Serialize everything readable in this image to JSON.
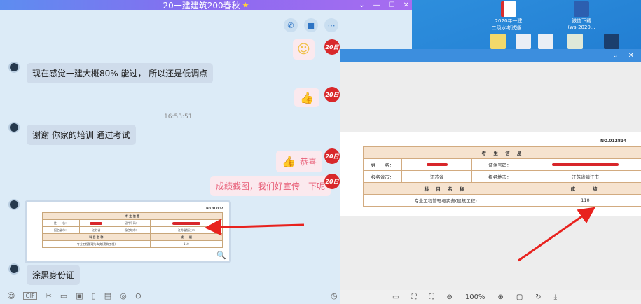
{
  "chat": {
    "title": "20一建建筑200春秋",
    "title_star": "★",
    "timestamp": "16:53:51",
    "messages": [
      {
        "side": "right",
        "kind": "emoji",
        "glyph": "☺"
      },
      {
        "side": "left",
        "text": "现在感觉一建大概80% 能过， 所以还是低调点"
      },
      {
        "side": "right",
        "kind": "thumb",
        "glyph": "👍"
      },
      {
        "side": "left",
        "text": "谢谢 你家的培训 通过考试"
      },
      {
        "side": "right",
        "kind": "thumb-text",
        "glyph": "👍",
        "text": "恭喜"
      },
      {
        "side": "right",
        "text": "成绩截图，我们好宣传一下呢"
      },
      {
        "side": "left",
        "kind": "image"
      },
      {
        "side": "left",
        "text": "涂黑身份证"
      }
    ],
    "avatar_right_label": "20日",
    "top_icons": [
      "phone-icon",
      "video-icon",
      "more-icon"
    ],
    "bottom_icons": [
      "emoji-icon",
      "gif-icon",
      "scissors-icon",
      "folder-icon",
      "image-icon",
      "phone-icon",
      "calendar-icon",
      "voice-icon",
      "more-icon",
      "clock-icon"
    ],
    "gif_label": "GIF"
  },
  "desktop": {
    "icons": [
      {
        "label1": "2020年一建",
        "label2": "二级水考试通..."
      },
      {
        "label1": "微信下载",
        "label2": "(ws-2020..."
      }
    ]
  },
  "score_table": {
    "doc_no": "NO.012814",
    "header": "考 生 信 息",
    "name_label": "姓　　名：",
    "id_label": "证件号码：",
    "province_label": "报名省市：",
    "province_value": "江苏省",
    "city_label": "报名地市：",
    "city_value": "江苏省镇江市",
    "subject_header": "科 目 名 称",
    "score_header": "成　　绩",
    "subject": "专业工程管理与实务(建筑工程)",
    "score": "110"
  },
  "viewer": {
    "title_icons": [
      "chevron-down-icon",
      "close-icon"
    ],
    "zoom": "100%"
  },
  "colors": {
    "accent": "#3c8ede",
    "arrow": "#e8221e",
    "bubble_right_text": "#e85f78"
  }
}
